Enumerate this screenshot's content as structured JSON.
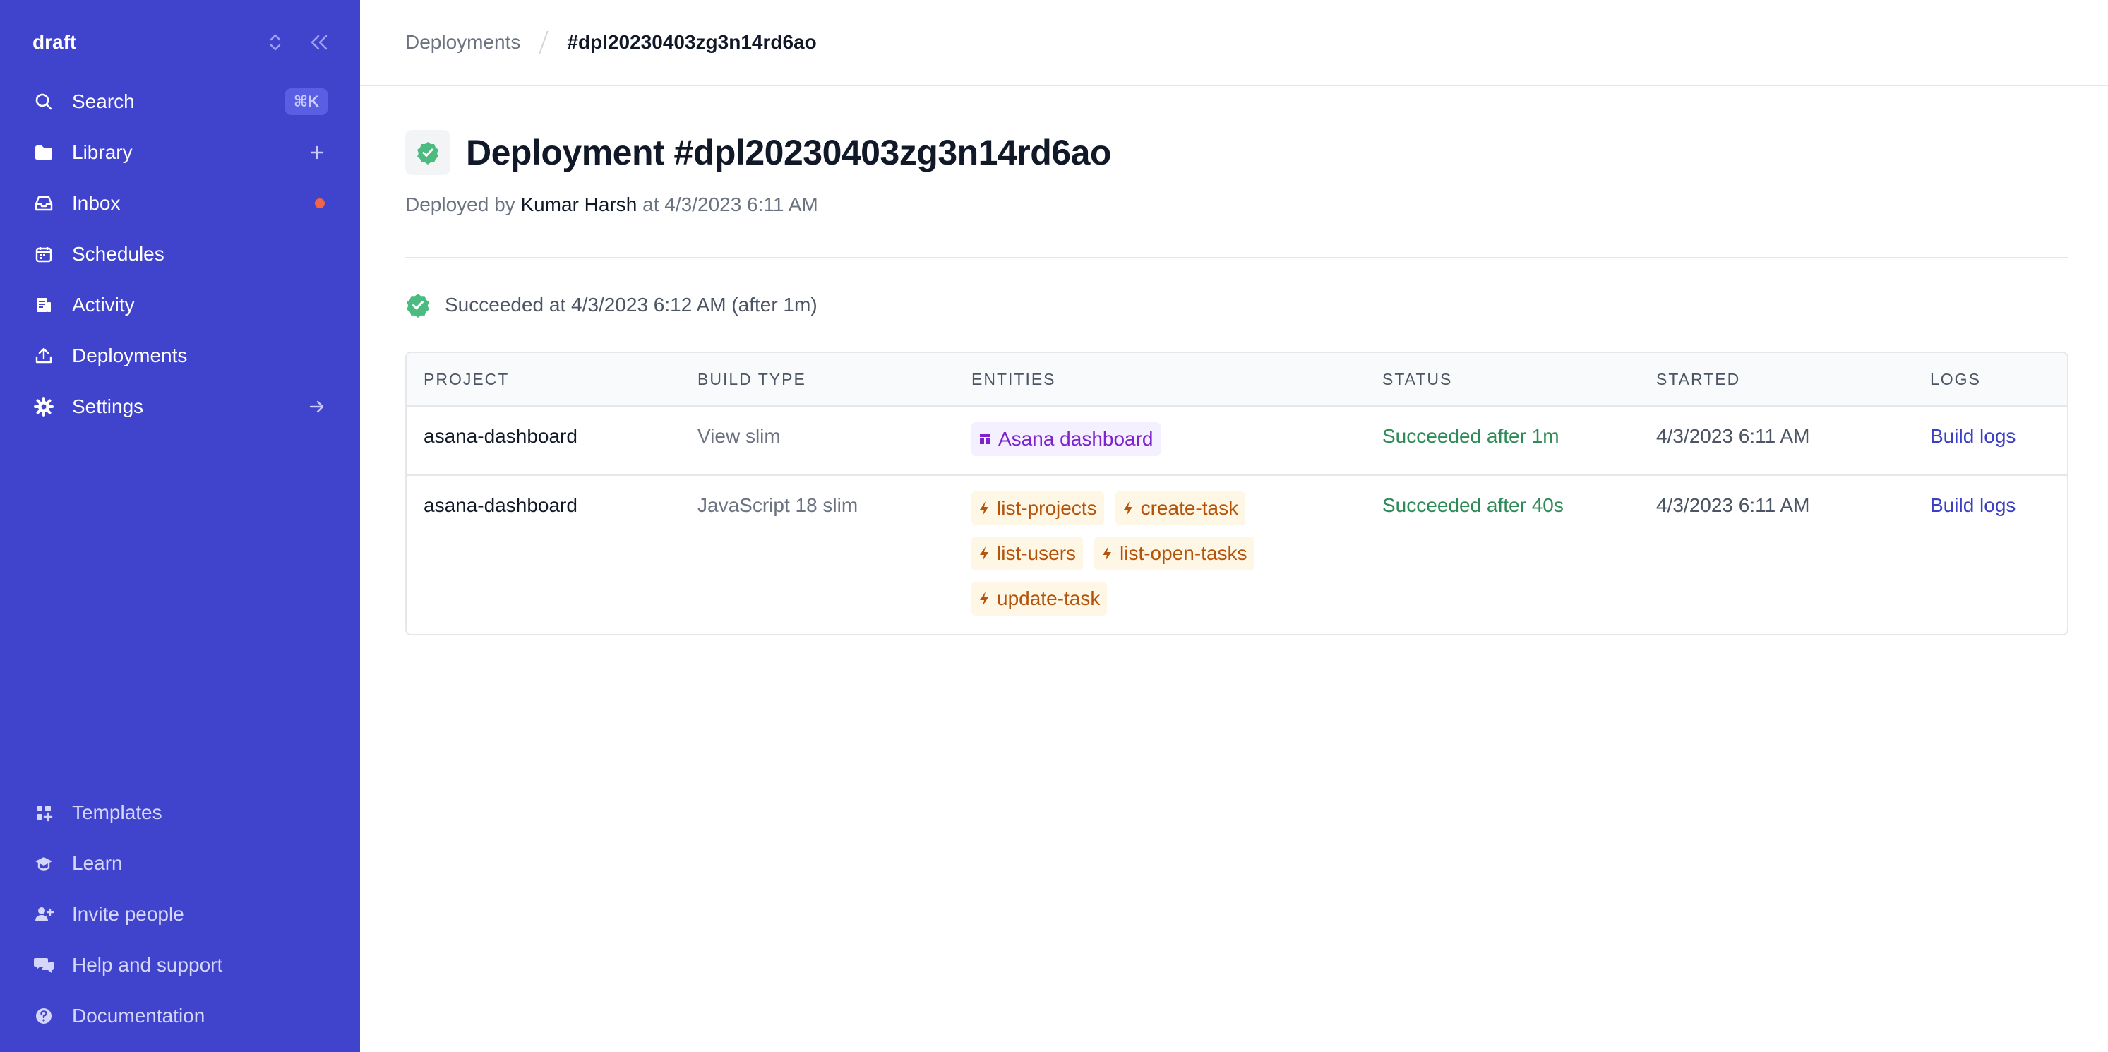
{
  "sidebar": {
    "workspace": "draft",
    "nav": [
      {
        "label": "Search",
        "icon": "search-icon",
        "shortcut": "⌘K"
      },
      {
        "label": "Library",
        "icon": "folder-icon"
      },
      {
        "label": "Inbox",
        "icon": "inbox-icon"
      },
      {
        "label": "Schedules",
        "icon": "calendar-icon"
      },
      {
        "label": "Activity",
        "icon": "activity-icon"
      },
      {
        "label": "Deployments",
        "icon": "upload-icon"
      },
      {
        "label": "Settings",
        "icon": "gear-icon"
      }
    ],
    "footer": [
      {
        "label": "Templates",
        "icon": "grid-icon"
      },
      {
        "label": "Learn",
        "icon": "graduation-cap-icon"
      },
      {
        "label": "Invite people",
        "icon": "user-plus-icon"
      },
      {
        "label": "Help and support",
        "icon": "chat-icon"
      },
      {
        "label": "Documentation",
        "icon": "question-icon"
      }
    ]
  },
  "breadcrumb": {
    "parent": "Deployments",
    "current": "#dpl20230403zg3n14rd6ao"
  },
  "deployment": {
    "title": "Deployment #dpl20230403zg3n14rd6ao",
    "deployed_prefix": "Deployed by",
    "author": "Kumar Harsh",
    "deployed_suffix": "at 4/3/2023 6:11 AM",
    "result": "Succeeded at 4/3/2023 6:12 AM (after 1m)"
  },
  "table": {
    "headers": [
      "PROJECT",
      "BUILD TYPE",
      "ENTITIES",
      "STATUS",
      "STARTED",
      "LOGS"
    ],
    "rows": [
      {
        "project": "asana-dashboard",
        "build_type": "View slim",
        "entities": [
          "Asana dashboard"
        ],
        "status": "Succeeded after 1m",
        "started": "4/3/2023 6:11 AM",
        "logs": "Build logs"
      },
      {
        "project": "asana-dashboard",
        "build_type": "JavaScript 18 slim",
        "entities": [
          "list-projects",
          "create-task",
          "list-users",
          "list-open-tasks",
          "update-task"
        ],
        "status": "Succeeded after 40s",
        "started": "4/3/2023 6:11 AM",
        "logs": "Build logs"
      }
    ]
  },
  "colors": {
    "sidebar_bg": "#4043cc",
    "success": "#2e8b57",
    "link": "#3b3fc4"
  }
}
